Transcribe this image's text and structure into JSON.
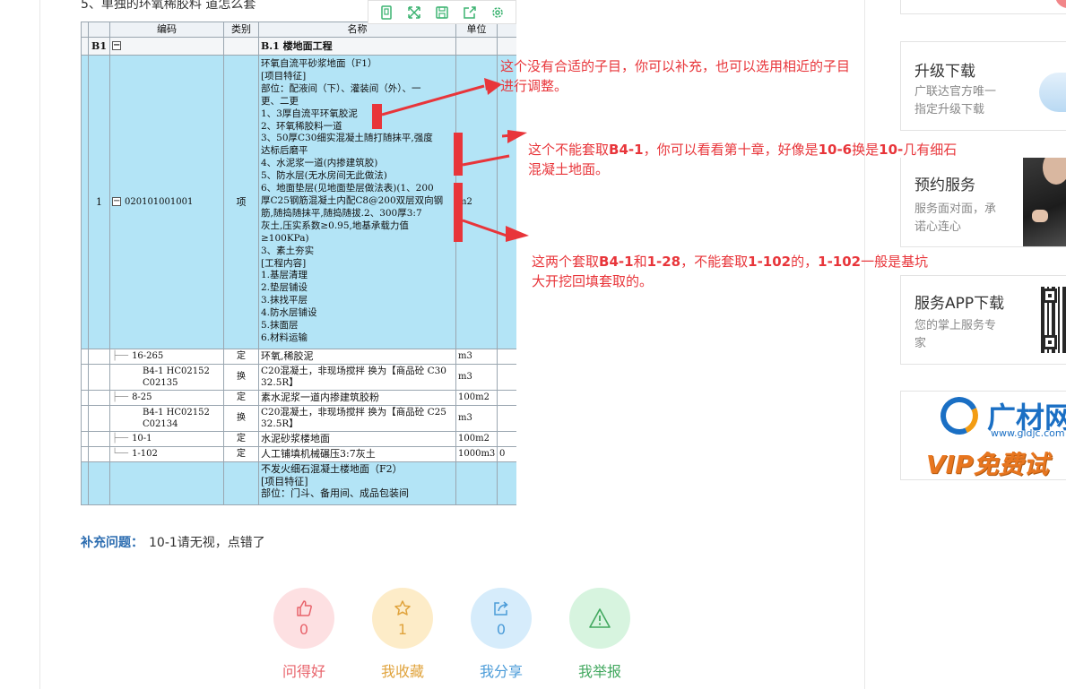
{
  "question": {
    "title": "5、单独的环氧稀胶料  道怎么套"
  },
  "toolbar": {
    "icons": [
      "copy-icon",
      "expand-icon",
      "save-icon",
      "export-icon",
      "settings-icon"
    ]
  },
  "table": {
    "headers": [
      "编码",
      "类别",
      "名称",
      "单位"
    ],
    "b1": {
      "num": "B1",
      "name": "B.1  楼地面工程"
    },
    "main_row": {
      "num": "1",
      "code": "020101001001",
      "type": "项",
      "unit": "m2",
      "lines": [
        "环氧自流平砂浆地面（F1）",
        "[项目特征]",
        "部位：配液间（下）、灌装间（外）、一",
        "更、二更",
        "1、3厚自流平环氧胶泥",
        "2、环氧稀胶料一道",
        "3、50厚C30细实混凝土随打随抹平,强度",
        "达标后磨平",
        "4、水泥浆一道(内掺建筑胶)",
        "5、防水层(无水房间无此做法)",
        "6、地面垫层(见地面垫层做法表)(1、200",
        "厚C25钢筋混凝土内配C8@200双层双向钢",
        "筋,随捣随抹平,随捣随拔.2、300厚3:7",
        "灰土,压实系数≥0.95,地基承载力值",
        "≥100KPa)",
        "3、素土夯实",
        "[工程内容]",
        "1.基层清理",
        "2.垫层铺设",
        "3.抹找平层",
        "4.防水层铺设",
        "5.抹面层",
        "6.材料运输"
      ]
    },
    "sub_rows": [
      {
        "code": "16-265",
        "type": "定",
        "name": "环氧,稀胶泥",
        "unit": "m3"
      },
      {
        "code": "B4-1 HC02152 C02135",
        "type": "换",
        "name": "C20混凝土，非现场搅拌  换为【商品砼 C30 32.5R】",
        "unit": "m3"
      },
      {
        "code": "8-25",
        "type": "定",
        "name": "素水泥浆一道内掺建筑胶粉",
        "unit": "100m2"
      },
      {
        "code": "B4-1 HC02152 C02134",
        "type": "换",
        "name": "C20混凝土，非现场搅拌  换为【商品砼 C25 32.5R】",
        "unit": "m3"
      },
      {
        "code": "10-1",
        "type": "定",
        "name": "水泥砂浆楼地面",
        "unit": "100m2"
      },
      {
        "code": "1-102",
        "type": "定",
        "name": "人工铺填机械碾压3:7灰土",
        "unit": "1000m3",
        "extra": "0"
      }
    ],
    "next_row": {
      "lines": [
        "不发火细石混凝土楼地面（F2）",
        "[项目特征]",
        "部位：门斗、备用间、成品包装间"
      ]
    }
  },
  "annotations": {
    "a1_l1": "这个没有合适的子目，你可以补充，也可以选用相近的子目",
    "a1_l2": "进行调整。",
    "a2_l1_p1": "这个不能套取",
    "a2_l1_b1": "B4-1",
    "a2_l1_p2": "，你可以看看第十章，好像是",
    "a2_l1_b2": "10-6",
    "a2_l1_p3": "换是",
    "a2_l1_b3": "10-",
    "a2_l1_p4": "几有细石",
    "a2_l2": "混凝土地面。",
    "a3_l1_p1": "这两个套取",
    "a3_l1_b1": "B4-1",
    "a3_l1_p2": "和",
    "a3_l1_b2": "1-28",
    "a3_l1_p3": "，不能套取",
    "a3_l1_b3": "1-102",
    "a3_l1_p4": "的，",
    "a3_l1_b4": "1-102",
    "a3_l1_p5": "一般是基坑",
    "a3_l2": "大开挖回填套取的。"
  },
  "supplement": {
    "label": "补充问题：",
    "text": "10-1请无视，点错了"
  },
  "actions": [
    {
      "icon": "thumbs-up-icon",
      "count": "0",
      "label": "问得好",
      "color": "#e8636b",
      "bg": "#fde0e2"
    },
    {
      "icon": "star-icon",
      "count": "1",
      "label": "我收藏",
      "color": "#e0a33c",
      "bg": "#fdecc8"
    },
    {
      "icon": "share-icon",
      "count": "0",
      "label": "我分享",
      "color": "#4a9bd8",
      "bg": "#d6ecfb"
    },
    {
      "icon": "warning-icon",
      "count": "",
      "label": "我举报",
      "color": "#42a85f",
      "bg": "#d7f4df"
    }
  ],
  "sidebar": {
    "upgrade": {
      "title": "升级下载",
      "desc1": "广联达官方唯一",
      "desc2": "指定升级下载"
    },
    "appointment": {
      "title": "预约服务",
      "desc1": "服务面对面，承",
      "desc2": "诺心连心"
    },
    "app": {
      "title": "服务APP下载",
      "desc1": "您的掌上服务专",
      "desc2": "家"
    },
    "ad": {
      "brand": "广材网",
      "url": "www.gldjc.com",
      "slogan": "VIP免费试"
    }
  }
}
